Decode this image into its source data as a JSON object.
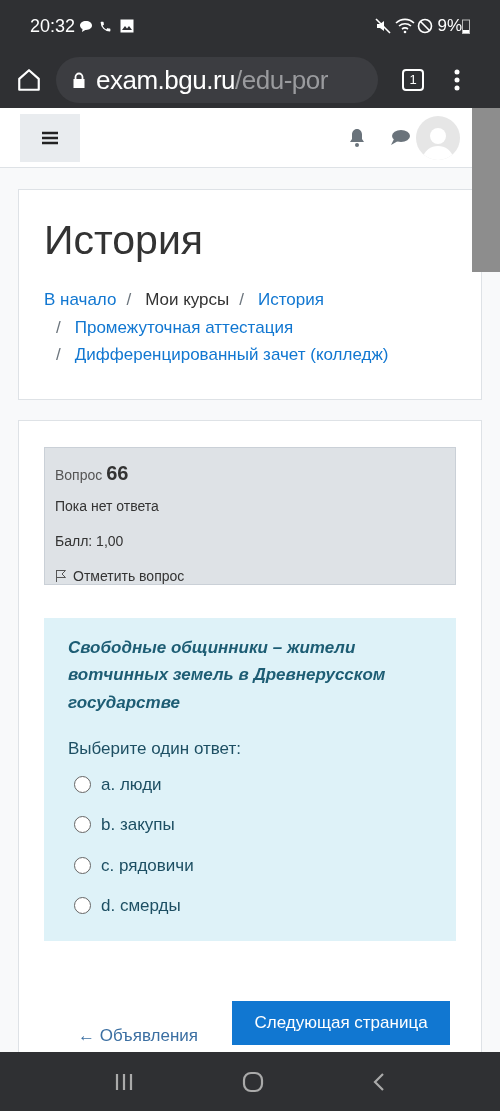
{
  "status_bar": {
    "time": "20:32",
    "battery": "9%"
  },
  "browser": {
    "url_host": "exam.bgu.ru",
    "url_path": "/edu-por",
    "tab_count": "1"
  },
  "page": {
    "title": "История",
    "breadcrumb_separator": "/",
    "breadcrumb_lines": [
      [
        {
          "text": "В начало",
          "link": true
        },
        {
          "text": "Мои курсы",
          "link": false
        },
        {
          "text": "История",
          "link": true
        }
      ],
      [
        {
          "text": "Промежуточная аттестация",
          "link": true
        }
      ],
      [
        {
          "text": "Дифференцированный зачет (колледж)",
          "link": true
        }
      ]
    ]
  },
  "question": {
    "label": "Вопрос",
    "number": "66",
    "status": "Пока нет ответа",
    "grade": "Балл: 1,00",
    "flag": "Отметить вопрос",
    "text": "Свободные общинники – жители вотчинных земель в Древнерусском государстве",
    "prompt": "Выберите один ответ:",
    "options": [
      {
        "text": "a. люди",
        "selected": false
      },
      {
        "text": "b. закупы",
        "selected": false
      },
      {
        "text": "c. рядовичи",
        "selected": false
      },
      {
        "text": "d. смерды",
        "selected": false
      }
    ]
  },
  "navigation": {
    "previous": "← Объявления",
    "next": "Следующая страница"
  }
}
